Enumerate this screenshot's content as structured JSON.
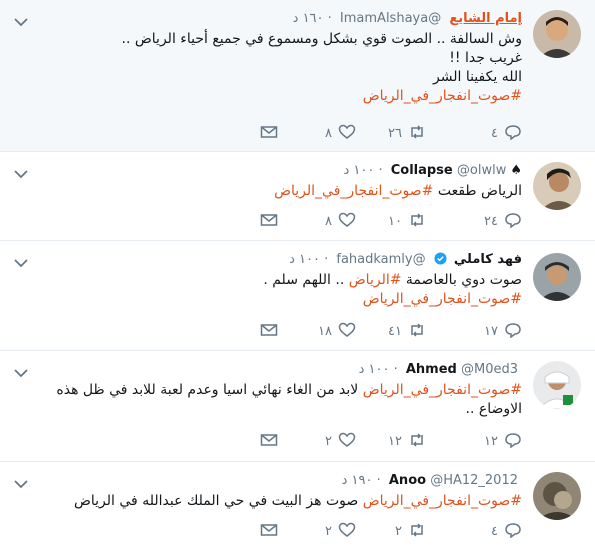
{
  "tweets": [
    {
      "name": "إمام الشايع",
      "handle": "@ImamAlshaya",
      "time": "١٦٠ د",
      "lines": [
        "وش السالفة .. الصوت قوي بشكل ومسموع في جميع أحياء الرياض ..",
        "غريب جدا !!",
        "الله يكفينا الشر"
      ],
      "hashtag": "#صوت_انفجار_في_الرياض",
      "replies": "٤",
      "retweets": "٢٦",
      "likes": "٨"
    },
    {
      "name": "Collapse",
      "handle": "@olwlw",
      "time": "١٠٠ د",
      "text": "الرياض طقعت",
      "hashtag": "#صوت_انفجار_في_الرياض",
      "replies": "٢٤",
      "retweets": "١٠",
      "likes": "٨"
    },
    {
      "name": "فهد كاملي",
      "handle": "@fahadkamly",
      "time": "١٠٠ د",
      "text1": "صوت دوي بالعاصمة",
      "hashtag_inline": "#الرياض",
      "text2": ".. اللهم سلم .",
      "hashtag": "#صوت_انفجار_في_الرياض",
      "replies": "١٧",
      "retweets": "٤١",
      "likes": "١٨"
    },
    {
      "name": "Ahmed",
      "handle": "@M0ed3",
      "time": "١٠٠ د",
      "hashtag": "#صوت_انفجار_في_الرياض",
      "text": "لابد من الغاء نهائي اسيا وعدم لعبة للابد في ظل هذه",
      "text_line2": "الاوضاع ..",
      "replies": "١٢",
      "retweets": "١٢",
      "likes": "٢"
    },
    {
      "name": "Anoo",
      "handle": "@HA12_2012",
      "time": "١٩٠ د",
      "hashtag": "#صوت_انفجار_في_الرياض",
      "text": "صوت هز البيت في حي الملك عبدالله في الرياض",
      "replies": "٤",
      "retweets": "٢",
      "likes": "٢"
    }
  ],
  "colors": {
    "link": "#e0531d",
    "muted": "#657786",
    "verified": "#1da1f2"
  }
}
